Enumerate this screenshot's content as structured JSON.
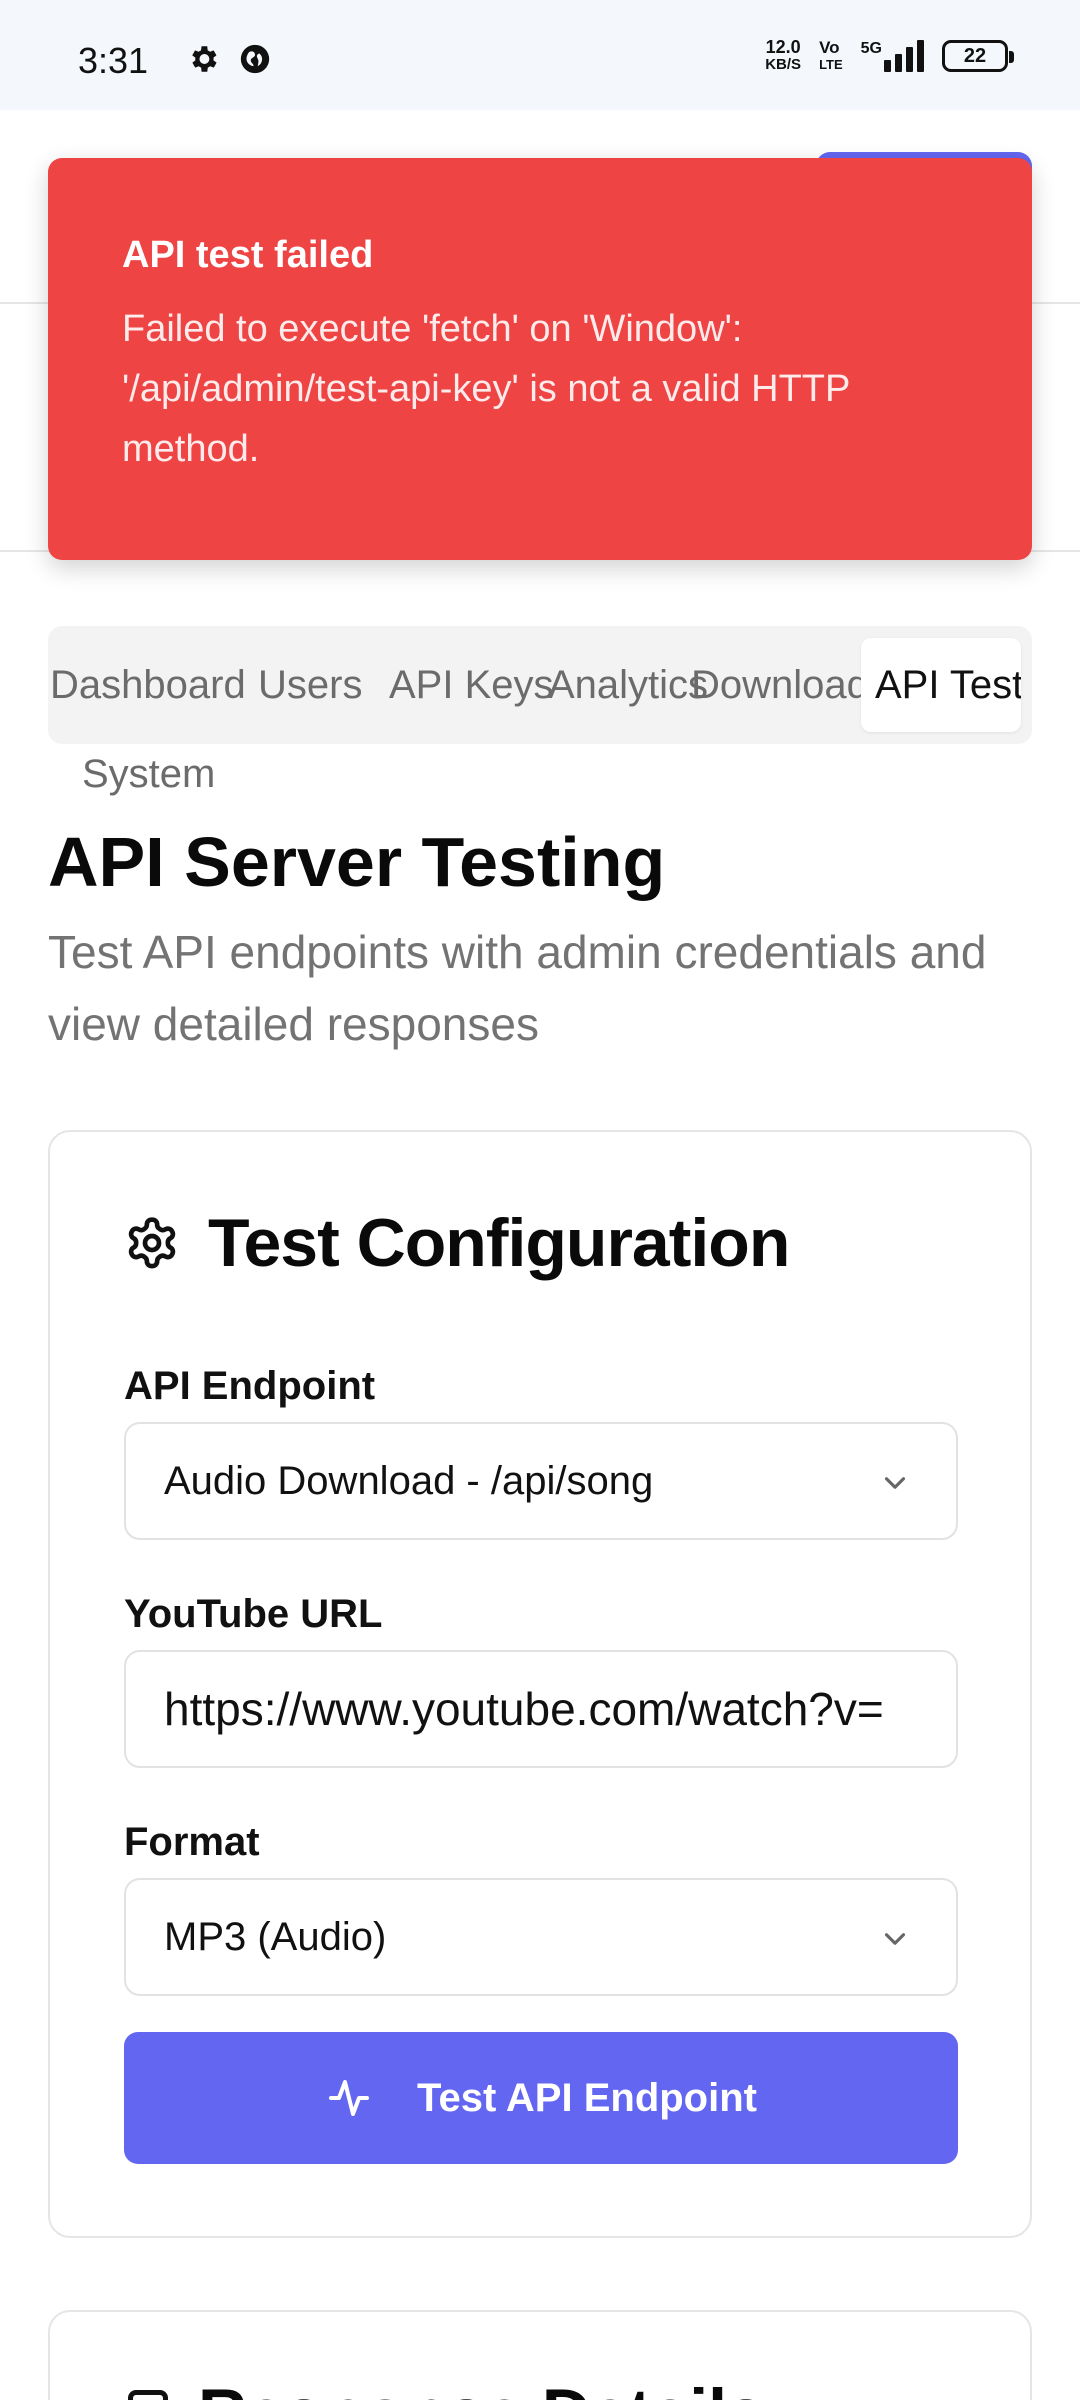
{
  "status_bar": {
    "time": "3:31",
    "net_speed_value": "12.0",
    "net_speed_unit": "KB/S",
    "volte_top": "Vo",
    "volte_bottom": "LTE",
    "network": "5G",
    "battery": "22",
    "icons": [
      "settings-icon",
      "vpn-globe-icon",
      "signal-icon",
      "battery-icon"
    ]
  },
  "toast": {
    "title": "API test failed",
    "message": "Failed to execute 'fetch' on 'Window': '/api/admin/test-api-key' is not a valid HTTP method.",
    "color": "#ef4444"
  },
  "tabs": [
    {
      "label": "Dashboard",
      "active": false
    },
    {
      "label": "Users",
      "active": false
    },
    {
      "label": "API Keys",
      "active": false
    },
    {
      "label": "Analytics",
      "active": false
    },
    {
      "label": "Downloads",
      "active": false
    },
    {
      "label": "API Test",
      "active": true
    },
    {
      "label": "System",
      "active": false
    }
  ],
  "page": {
    "title": "API Server Testing",
    "subtitle": "Test API endpoints with admin credentials and view detailed responses"
  },
  "config": {
    "title": "Test Configuration",
    "icon": "settings-icon",
    "endpoint_label": "API Endpoint",
    "endpoint_value": "Audio Download - /api/song",
    "url_label": "YouTube URL",
    "url_value": "https://www.youtube.com/watch?v=",
    "format_label": "Format",
    "format_value": "MP3 (Audio)",
    "button_label": "Test API Endpoint",
    "button_icon": "activity-icon",
    "accent": "#6366f1"
  },
  "response_card": {
    "title": "Response Details"
  }
}
